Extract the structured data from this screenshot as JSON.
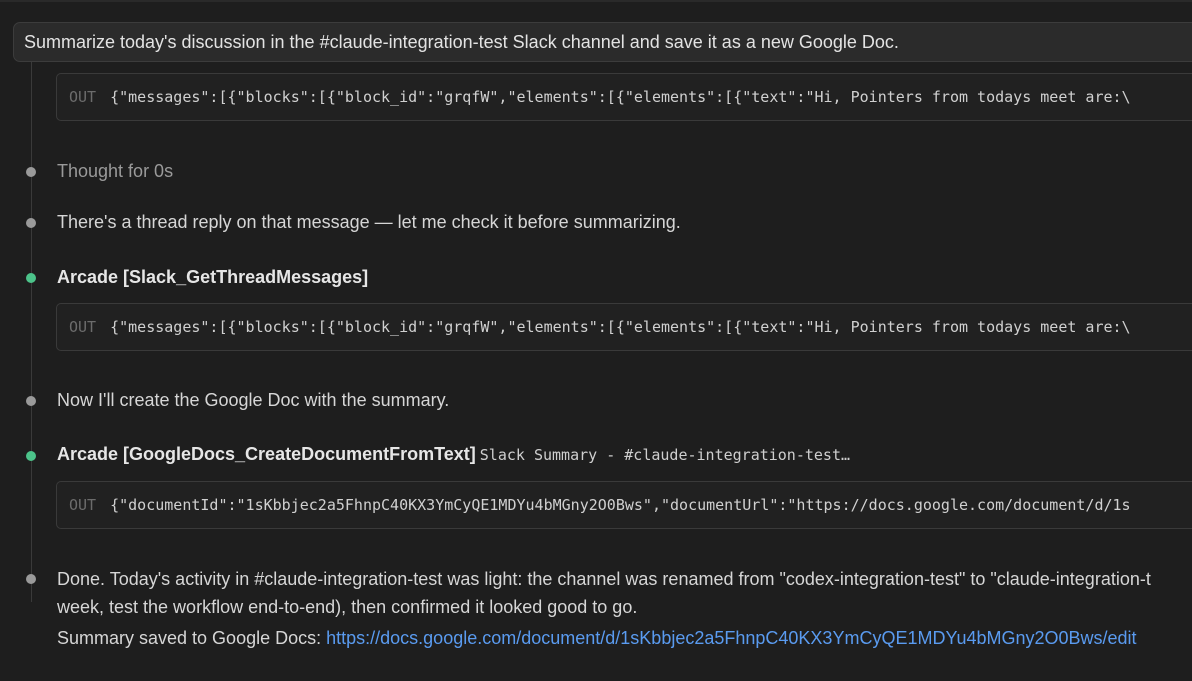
{
  "prompt": {
    "text": "Summarize today's discussion in the #claude-integration-test Slack channel and save it as a new Google Doc."
  },
  "out_label": "OUT",
  "outputs": {
    "first": "{\"messages\":[{\"blocks\":[{\"block_id\":\"grqfW\",\"elements\":[{\"elements\":[{\"text\":\"Hi, Pointers from todays meet are:\\",
    "thread": "{\"messages\":[{\"blocks\":[{\"block_id\":\"grqfW\",\"elements\":[{\"elements\":[{\"text\":\"Hi, Pointers from todays meet are:\\",
    "doc": "{\"documentId\":\"1sKbbjec2a5FhnpC40KX3YmCyQE1MDYu4bMGny2O0Bws\",\"documentUrl\":\"https://docs.google.com/document/d/1s"
  },
  "steps": {
    "thought": "Thought for 0s",
    "thread_note": "There's a thread reply on that message — let me check it before summarizing.",
    "tool1_name": "Arcade [Slack_GetThreadMessages]",
    "create_note": "Now I'll create the Google Doc with the summary.",
    "tool2_name": "Arcade [GoogleDocs_CreateDocumentFromText]",
    "tool2_arg": "Slack Summary - #claude-integration-test…"
  },
  "final": {
    "line1": "Done. Today's activity in #claude-integration-test was light: the channel was renamed from \"codex-integration-test\" to \"claude-integration-t",
    "line2": "week, test the workflow end-to-end), then confirmed it looked good to go.",
    "saved_label": "Summary saved to Google Docs: ",
    "url": "https://docs.google.com/document/d/1sKbbjec2a5FhnpC40KX3YmCyQE1MDYu4bMGny2O0Bws/edit"
  },
  "colors": {
    "background": "#1e1e1e",
    "tool_dot": "#4cc38a",
    "step_dot": "#9a9a9a",
    "link": "#5a9bf0"
  }
}
